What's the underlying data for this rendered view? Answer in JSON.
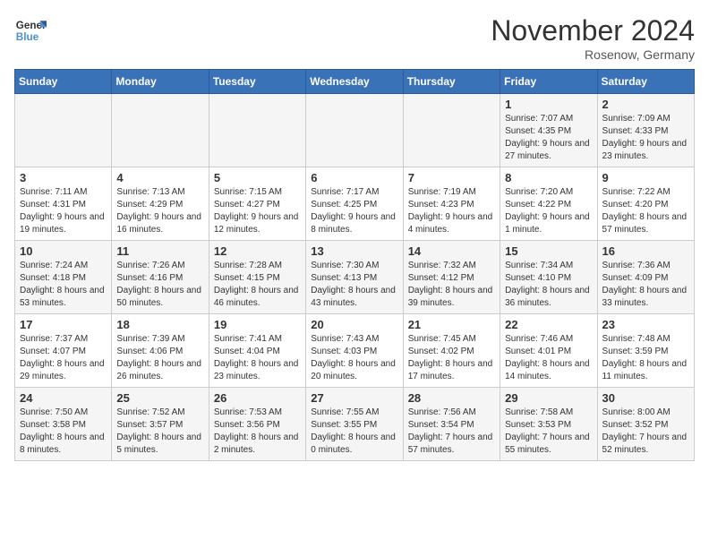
{
  "header": {
    "logo_line1": "General",
    "logo_line2": "Blue",
    "month": "November 2024",
    "location": "Rosenow, Germany"
  },
  "days_of_week": [
    "Sunday",
    "Monday",
    "Tuesday",
    "Wednesday",
    "Thursday",
    "Friday",
    "Saturday"
  ],
  "weeks": [
    [
      {
        "day": "",
        "info": ""
      },
      {
        "day": "",
        "info": ""
      },
      {
        "day": "",
        "info": ""
      },
      {
        "day": "",
        "info": ""
      },
      {
        "day": "",
        "info": ""
      },
      {
        "day": "1",
        "info": "Sunrise: 7:07 AM\nSunset: 4:35 PM\nDaylight: 9 hours and 27 minutes."
      },
      {
        "day": "2",
        "info": "Sunrise: 7:09 AM\nSunset: 4:33 PM\nDaylight: 9 hours and 23 minutes."
      }
    ],
    [
      {
        "day": "3",
        "info": "Sunrise: 7:11 AM\nSunset: 4:31 PM\nDaylight: 9 hours and 19 minutes."
      },
      {
        "day": "4",
        "info": "Sunrise: 7:13 AM\nSunset: 4:29 PM\nDaylight: 9 hours and 16 minutes."
      },
      {
        "day": "5",
        "info": "Sunrise: 7:15 AM\nSunset: 4:27 PM\nDaylight: 9 hours and 12 minutes."
      },
      {
        "day": "6",
        "info": "Sunrise: 7:17 AM\nSunset: 4:25 PM\nDaylight: 9 hours and 8 minutes."
      },
      {
        "day": "7",
        "info": "Sunrise: 7:19 AM\nSunset: 4:23 PM\nDaylight: 9 hours and 4 minutes."
      },
      {
        "day": "8",
        "info": "Sunrise: 7:20 AM\nSunset: 4:22 PM\nDaylight: 9 hours and 1 minute."
      },
      {
        "day": "9",
        "info": "Sunrise: 7:22 AM\nSunset: 4:20 PM\nDaylight: 8 hours and 57 minutes."
      }
    ],
    [
      {
        "day": "10",
        "info": "Sunrise: 7:24 AM\nSunset: 4:18 PM\nDaylight: 8 hours and 53 minutes."
      },
      {
        "day": "11",
        "info": "Sunrise: 7:26 AM\nSunset: 4:16 PM\nDaylight: 8 hours and 50 minutes."
      },
      {
        "day": "12",
        "info": "Sunrise: 7:28 AM\nSunset: 4:15 PM\nDaylight: 8 hours and 46 minutes."
      },
      {
        "day": "13",
        "info": "Sunrise: 7:30 AM\nSunset: 4:13 PM\nDaylight: 8 hours and 43 minutes."
      },
      {
        "day": "14",
        "info": "Sunrise: 7:32 AM\nSunset: 4:12 PM\nDaylight: 8 hours and 39 minutes."
      },
      {
        "day": "15",
        "info": "Sunrise: 7:34 AM\nSunset: 4:10 PM\nDaylight: 8 hours and 36 minutes."
      },
      {
        "day": "16",
        "info": "Sunrise: 7:36 AM\nSunset: 4:09 PM\nDaylight: 8 hours and 33 minutes."
      }
    ],
    [
      {
        "day": "17",
        "info": "Sunrise: 7:37 AM\nSunset: 4:07 PM\nDaylight: 8 hours and 29 minutes."
      },
      {
        "day": "18",
        "info": "Sunrise: 7:39 AM\nSunset: 4:06 PM\nDaylight: 8 hours and 26 minutes."
      },
      {
        "day": "19",
        "info": "Sunrise: 7:41 AM\nSunset: 4:04 PM\nDaylight: 8 hours and 23 minutes."
      },
      {
        "day": "20",
        "info": "Sunrise: 7:43 AM\nSunset: 4:03 PM\nDaylight: 8 hours and 20 minutes."
      },
      {
        "day": "21",
        "info": "Sunrise: 7:45 AM\nSunset: 4:02 PM\nDaylight: 8 hours and 17 minutes."
      },
      {
        "day": "22",
        "info": "Sunrise: 7:46 AM\nSunset: 4:01 PM\nDaylight: 8 hours and 14 minutes."
      },
      {
        "day": "23",
        "info": "Sunrise: 7:48 AM\nSunset: 3:59 PM\nDaylight: 8 hours and 11 minutes."
      }
    ],
    [
      {
        "day": "24",
        "info": "Sunrise: 7:50 AM\nSunset: 3:58 PM\nDaylight: 8 hours and 8 minutes."
      },
      {
        "day": "25",
        "info": "Sunrise: 7:52 AM\nSunset: 3:57 PM\nDaylight: 8 hours and 5 minutes."
      },
      {
        "day": "26",
        "info": "Sunrise: 7:53 AM\nSunset: 3:56 PM\nDaylight: 8 hours and 2 minutes."
      },
      {
        "day": "27",
        "info": "Sunrise: 7:55 AM\nSunset: 3:55 PM\nDaylight: 8 hours and 0 minutes."
      },
      {
        "day": "28",
        "info": "Sunrise: 7:56 AM\nSunset: 3:54 PM\nDaylight: 7 hours and 57 minutes."
      },
      {
        "day": "29",
        "info": "Sunrise: 7:58 AM\nSunset: 3:53 PM\nDaylight: 7 hours and 55 minutes."
      },
      {
        "day": "30",
        "info": "Sunrise: 8:00 AM\nSunset: 3:52 PM\nDaylight: 7 hours and 52 minutes."
      }
    ]
  ]
}
